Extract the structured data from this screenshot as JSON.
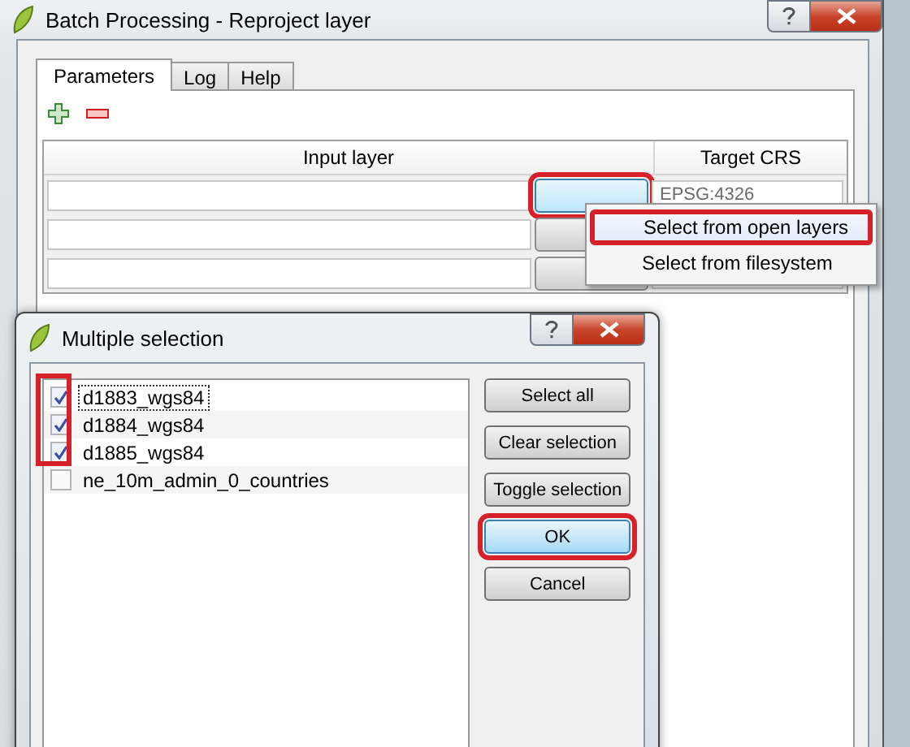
{
  "window": {
    "title": "Batch Processing - Reproject layer"
  },
  "tabs": [
    {
      "label": "Parameters",
      "selected": true
    },
    {
      "label": "Log",
      "selected": false
    },
    {
      "label": "Help",
      "selected": false
    }
  ],
  "table": {
    "columns": [
      "Input layer",
      "Target CRS"
    ],
    "rows": [
      {
        "button_hovered": true,
        "highlighted": true,
        "target_crs": "EPSG:4326"
      },
      {
        "button_hovered": false,
        "highlighted": false
      },
      {
        "button_hovered": false,
        "highlighted": false,
        "crs_field_visible": true
      }
    ]
  },
  "context_menu": {
    "items": [
      {
        "label": "Select from open layers",
        "selected": true,
        "highlighted": true
      },
      {
        "label": "Select from filesystem",
        "selected": false,
        "highlighted": false
      }
    ]
  },
  "dialog": {
    "title": "Multiple selection",
    "checkbox_column_highlighted": true,
    "items": [
      {
        "label": "d1883_wgs84",
        "checked": true,
        "focused": true
      },
      {
        "label": "d1884_wgs84",
        "checked": true,
        "focused": false
      },
      {
        "label": "d1885_wgs84",
        "checked": true,
        "focused": false
      },
      {
        "label": "ne_10m_admin_0_countries",
        "checked": false,
        "focused": false
      }
    ],
    "buttons": [
      {
        "label": "Select all",
        "default": false,
        "highlighted": false
      },
      {
        "label": "Clear selection",
        "default": false,
        "highlighted": false
      },
      {
        "label": "Toggle selection",
        "default": false,
        "highlighted": false
      },
      {
        "label": "OK",
        "default": true,
        "highlighted": true
      },
      {
        "label": "Cancel",
        "default": false,
        "highlighted": false
      }
    ]
  }
}
